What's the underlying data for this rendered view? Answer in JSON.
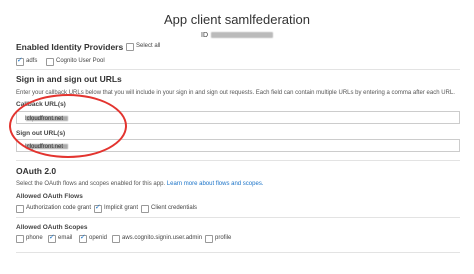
{
  "header": {
    "title": "App client samlfederation",
    "id_label": "ID"
  },
  "identity_providers": {
    "heading": "Enabled Identity Providers",
    "select_all": "Select all",
    "items": [
      {
        "label": "adfs",
        "checked": true
      },
      {
        "label": "Cognito User Pool",
        "checked": false
      }
    ]
  },
  "urls": {
    "heading": "Sign in and sign out URLs",
    "description": "Enter your callback URLs below that you will include in your sign in and sign out requests. Each field can contain multiple URLs by entering a comma after each URL.",
    "callback_label": "Callback URL(s)",
    "callback_prefix": "https://",
    "callback_suffix": ".cloudfront.net",
    "signout_label": "Sign out URL(s)",
    "signout_prefix": "https://",
    "signout_suffix": ".cloudfront.net"
  },
  "oauth": {
    "heading": "OAuth 2.0",
    "description": "Select the OAuth flows and scopes enabled for this app.",
    "learn_more": "Learn more about flows and scopes.",
    "flows_label": "Allowed OAuth Flows",
    "flows": [
      {
        "label": "Authorization code grant",
        "checked": false
      },
      {
        "label": "Implicit grant",
        "checked": true
      },
      {
        "label": "Client credentials",
        "checked": false
      }
    ],
    "scopes_label": "Allowed OAuth Scopes",
    "scopes": [
      {
        "label": "phone",
        "checked": false
      },
      {
        "label": "email",
        "checked": true
      },
      {
        "label": "openid",
        "checked": true
      },
      {
        "label": "aws.cognito.signin.user.admin",
        "checked": false
      },
      {
        "label": "profile",
        "checked": false
      }
    ]
  },
  "colors": {
    "annotation": "#e3342f",
    "link": "#1a73c8"
  }
}
